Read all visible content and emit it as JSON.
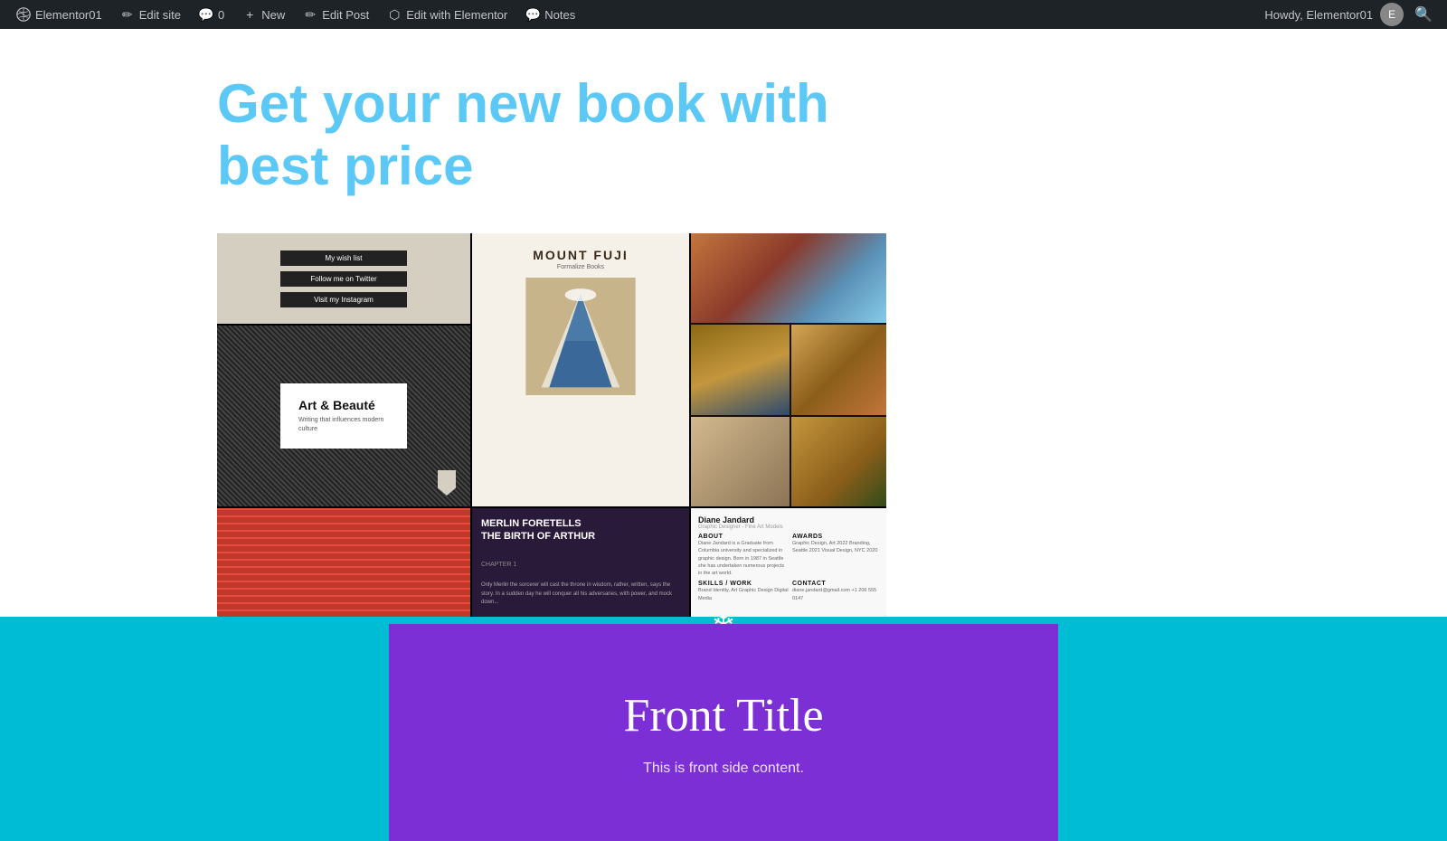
{
  "adminBar": {
    "wpSite": "Elementor01",
    "editSite": "Edit site",
    "comments": "0",
    "new": "New",
    "editPost": "Edit Post",
    "editWithElementor": "Edit with Elementor",
    "notes": "Notes",
    "howdy": "Howdy, Elementor01",
    "searchIcon": "search"
  },
  "hero": {
    "heading_line1": "Get your new book with",
    "heading_line2": "best price"
  },
  "books": {
    "mountFuji": {
      "title": "MOUNT FUJI",
      "subtitle": "Formalize Books"
    },
    "artBeaute": {
      "title": "Art & Beauté",
      "subtitle": "Writing that influences modern culture"
    },
    "merlin": {
      "title": "MERLIN FORETELLS",
      "title2": "THE BIRTH OF ARTHUR",
      "chapter": "CHAPTER 1",
      "text": "Only Merlin the sorcerer will cast the throne in wisdom, rather, written, says the story. In a sudden day he will conquer all his adversaries, with power, and mock down..."
    },
    "diane": {
      "name": "Diane Jandard",
      "subtitle": "Graphic Designer - Fine Art Models",
      "col1_title": "ABOUT",
      "col1_text": "Diane Jandard is a Graduate from Columbia university and specialized in graphic design. Born in 1987 in Seattle she has undertaken numerous projects in the art world.",
      "col2_title": "AWARDS",
      "col2_text": "Graphic Design, Art 2022\nBranding, Seattle 2021\nVisual Design, NYC 2020",
      "col3_title": "SKILLS / WORK",
      "col3_text": "Brand Identity, Art\nGraphic Design\nDigital Media",
      "col4_title": "CONTACT",
      "col4_text": "diane.jandard@gmail.com\n+1 206 555 0147"
    }
  },
  "flipCard": {
    "snowflake": "❄",
    "frontTitle": "Front Title",
    "frontContent": "This is front side content."
  },
  "btns": [
    "My wish list",
    "Follow me on Twitter",
    "Visit my Instagram"
  ]
}
